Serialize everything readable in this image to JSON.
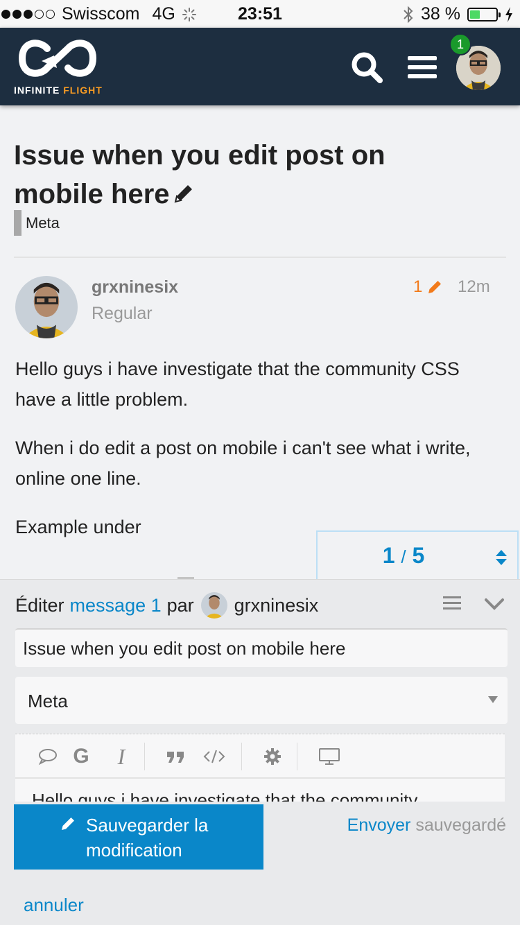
{
  "status_bar": {
    "carrier": "Swisscom",
    "network": "4G",
    "time": "23:51",
    "battery": "38 %",
    "battery_level": 0.38
  },
  "header": {
    "brand_primary": "INFINITE ",
    "brand_accent": "FLIGHT",
    "notification_count": "1",
    "colors": {
      "background": "#1d2e40",
      "accent": "#f59a23",
      "badge": "#1a9a2b"
    }
  },
  "topic": {
    "title": "Issue when you edit post on mobile here",
    "category": "Meta"
  },
  "post": {
    "username": "grxninesix",
    "user_title": "Regular",
    "edit_count": "1",
    "age": "12m",
    "paragraphs": [
      "Hello guys i have investigate that the community CSS have a little problem.",
      "When i do edit a post on mobile i can't see what i write, online one line.",
      "Example under"
    ]
  },
  "timeline": {
    "current": "1",
    "separator": "/",
    "total": "5"
  },
  "composer": {
    "action": "Éditer",
    "target_link": "message 1",
    "by": "par",
    "username": "grxninesix",
    "title_value": "Issue when you edit post on mobile here",
    "category_value": "Meta",
    "body_preview": "Hello guys i have investigate that the community",
    "save_label": "Sauvegarder la modification",
    "send_label": "Envoyer",
    "saved_label": "sauvegardé",
    "cancel_label": "annuler",
    "toolbar_icons": [
      "speech-bubble-icon",
      "bold-icon",
      "italic-icon",
      "quote-icon",
      "code-icon",
      "gear-icon",
      "preview-icon"
    ]
  }
}
